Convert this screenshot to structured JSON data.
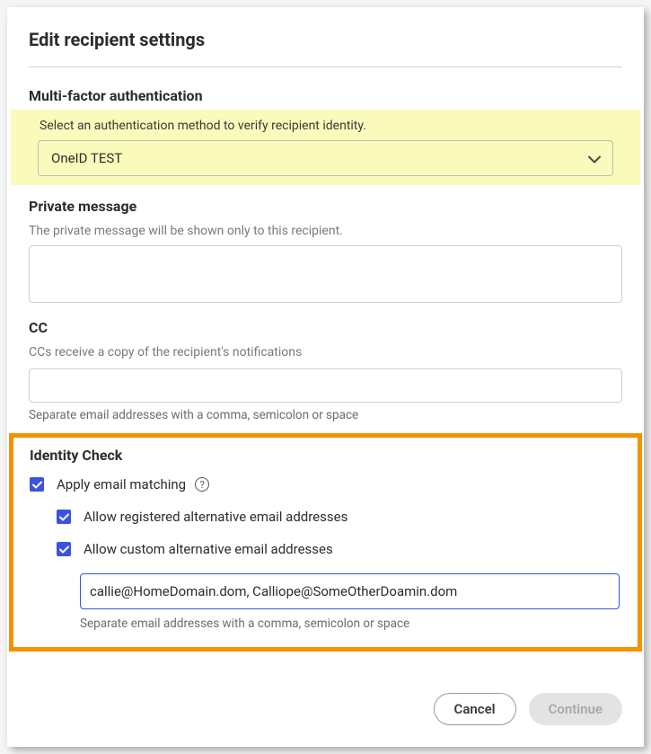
{
  "dialog": {
    "title": "Edit recipient settings"
  },
  "mfa": {
    "heading": "Multi-factor authentication",
    "help": "Select an authentication method to verify recipient identity.",
    "selected": "OneID TEST"
  },
  "privateMessage": {
    "heading": "Private message",
    "help": "The private message will be shown only to this recipient.",
    "value": ""
  },
  "cc": {
    "heading": "CC",
    "help": "CCs receive a copy of the recipient's notifications",
    "value": "",
    "caption": "Separate email addresses with a comma, semicolon or space"
  },
  "identityCheck": {
    "heading": "Identity Check",
    "applyEmailMatching": {
      "label": "Apply email matching",
      "checked": true
    },
    "allowRegistered": {
      "label": "Allow registered alternative email addresses",
      "checked": true
    },
    "allowCustom": {
      "label": "Allow custom alternative email addresses",
      "checked": true
    },
    "customEmails": "callie@HomeDomain.dom, Calliope@SomeOtherDoamin.dom",
    "customCaption": "Separate email addresses with a comma, semicolon or space"
  },
  "footer": {
    "cancel": "Cancel",
    "continue": "Continue"
  }
}
